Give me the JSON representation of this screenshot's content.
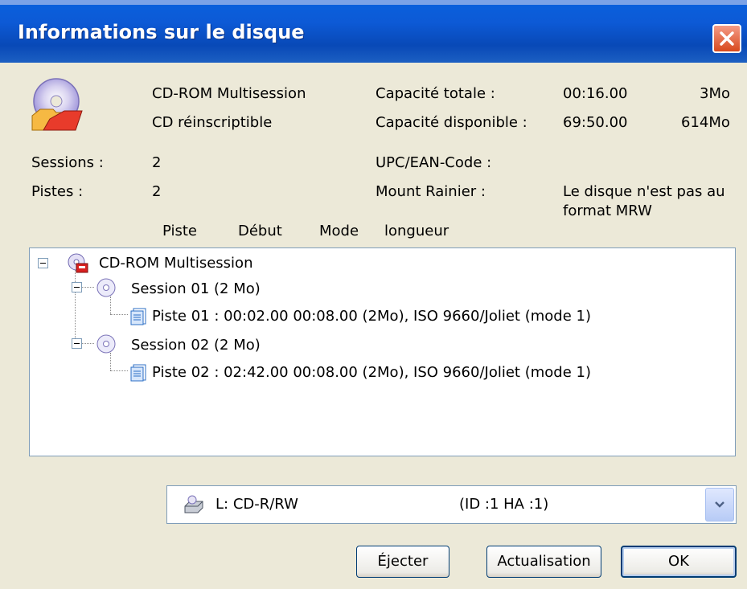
{
  "window": {
    "title": "Informations sur le disque"
  },
  "disc": {
    "type": "CD-ROM Multisession",
    "media": "CD réinscriptible",
    "sessions_label": "Sessions :",
    "sessions_value": "2",
    "tracks_label": "Pistes :",
    "tracks_value": "2"
  },
  "capacity": {
    "total_label": "Capacité totale :",
    "total_time": "00:16.00",
    "total_size": "3Mo",
    "available_label": "Capacité disponible :",
    "available_time": "69:50.00",
    "available_size": "614Mo",
    "upc_label": "UPC/EAN-Code :",
    "mount_label": "Mount Rainier :",
    "mount_value_1": "Le disque n'est pas au",
    "mount_value_2": "format MRW"
  },
  "columns": [
    "Piste",
    "Début",
    "Mode",
    "longueur"
  ],
  "tree": {
    "root": "CD-ROM Multisession",
    "sessions": [
      {
        "label": "Session 01 (2 Mo)",
        "track": "Piste 01 : 00:02.00   00:08.00   (2Mo),   ISO 9660/Joliet (mode 1)"
      },
      {
        "label": "Session 02 (2 Mo)",
        "track": "Piste 02 : 02:42.00   00:08.00   (2Mo),   ISO 9660/Joliet (mode 1)"
      }
    ]
  },
  "drive": {
    "name": "L: CD-R/RW",
    "id": "(ID :1  HA :1)"
  },
  "buttons": {
    "eject": "Éjecter",
    "refresh": "Actualisation",
    "ok": "OK"
  },
  "icons": [
    "disc-info-icon",
    "multisession-cd-icon",
    "session-cd-icon",
    "track-file-icon",
    "drive-icon",
    "close-icon",
    "dropdown-arrow-icon"
  ],
  "colors": {
    "titlebar": "#0a5fdc",
    "close": "#d8491d",
    "dialog": "#ece9d8",
    "border": "#7f9db9"
  }
}
